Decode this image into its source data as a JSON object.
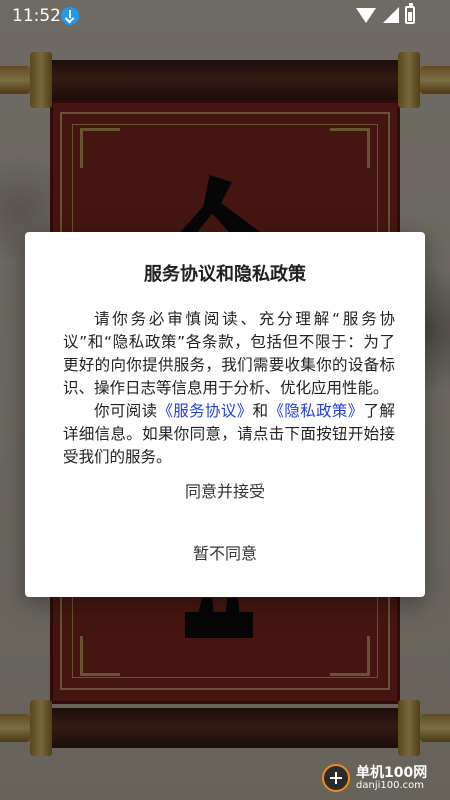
{
  "status_bar": {
    "time": "11:52",
    "icons": [
      "download-icon",
      "wifi-icon",
      "signal-icon",
      "battery-icon"
    ]
  },
  "background": {
    "colors": {
      "scroll_red": "#8a2c23",
      "gold": "#d1a664"
    }
  },
  "dialog": {
    "title": "服务协议和隐私政策",
    "paragraph1": "请你务必审慎阅读、充分理解“服务协议”和“隐私政策”各条款，包括但不限于：为了更好的向你提供服务，我们需要收集你的设备标识、操作日志等信息用于分析、优化应用性能。",
    "p2_prefix": "你可阅读",
    "p2_link1": "《服务协议》",
    "p2_and": "和",
    "p2_link2": "《隐私政策》",
    "p2_suffix": "了解详细信息。如果你同意，请点击下面按钮开始接受我们的服务。",
    "agree_button": "同意并接受",
    "disagree_button": "暂不同意",
    "link_color": "#1f3fe0"
  },
  "watermark": {
    "name": "单机100网",
    "domain": "danji100.com"
  }
}
